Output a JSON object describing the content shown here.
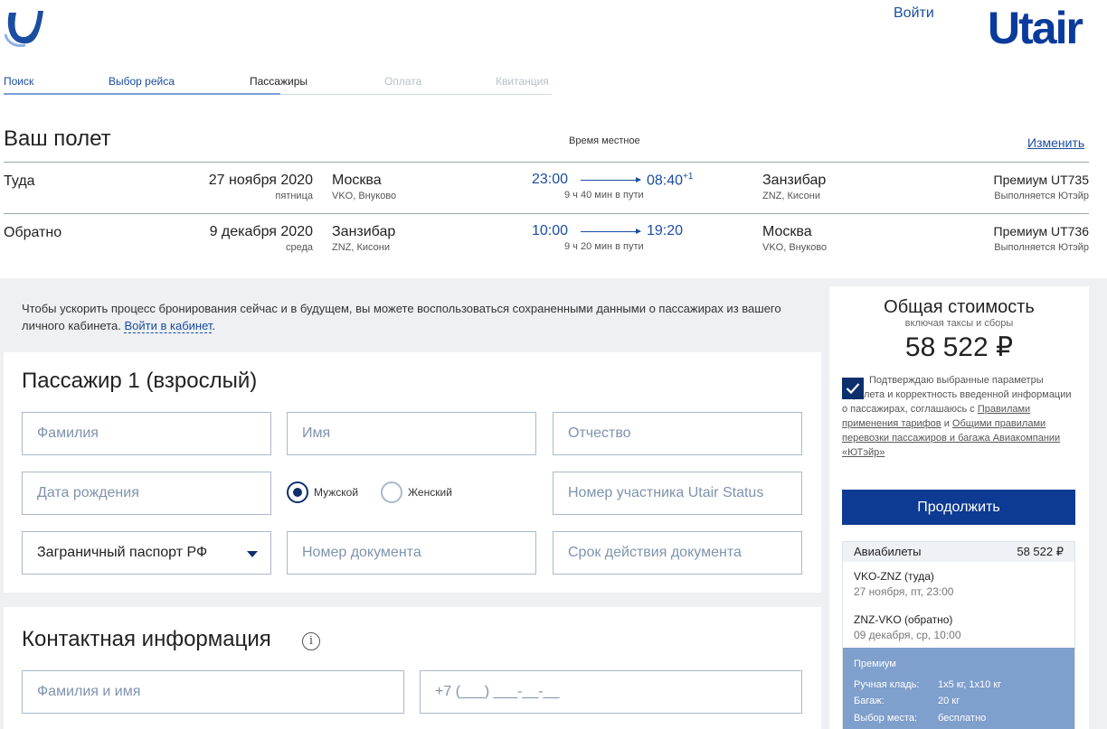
{
  "header": {
    "login": "Войти",
    "brand": "Utair"
  },
  "steps": [
    {
      "label": "Поиск",
      "state": "done"
    },
    {
      "label": "Выбор рейса",
      "state": "done"
    },
    {
      "label": "Пассажиры",
      "state": "active"
    },
    {
      "label": "Оплата",
      "state": "future"
    },
    {
      "label": "Квитанция",
      "state": "future"
    }
  ],
  "flight": {
    "title": "Ваш полет",
    "local_time_note": "Время местное",
    "change_link": "Изменить",
    "legs": [
      {
        "direction": "Туда",
        "date": "27 ноября 2020",
        "weekday": "пятница",
        "from_city": "Москва",
        "from_airport": "VKO, Внуково",
        "dep_time": "23:00",
        "arr_time": "08:40",
        "arr_day_offset": "+1",
        "duration": "9 ч 40 мин в пути",
        "to_city": "Занзибар",
        "to_airport": "ZNZ, Кисони",
        "fare": "Премиум UT735",
        "operator": "Выполняется Ютэйр"
      },
      {
        "direction": "Обратно",
        "date": "9 декабря 2020",
        "weekday": "среда",
        "from_city": "Занзибар",
        "from_airport": "ZNZ, Кисони",
        "dep_time": "10:00",
        "arr_time": "19:20",
        "arr_day_offset": "",
        "duration": "9 ч 20 мин в пути",
        "to_city": "Москва",
        "to_airport": "VKO, Внуково",
        "fare": "Премиум UT736",
        "operator": "Выполняется Ютэйр"
      }
    ]
  },
  "cabinet_note": {
    "text": "Чтобы ускорить процесс бронирования сейчас и в будущем, вы можете воспользоваться сохраненными данными о пассажирах из вашего личного кабинета.",
    "text_before_link": "Чтобы ускорить процесс бронирования сейчас и в будущем, вы можете воспользоваться сохраненными данными о пассажирах из вашего личного кабинета. ",
    "link": "Войти в кабинет",
    "after_link": "."
  },
  "passenger": {
    "title": "Пассажир 1 (взрослый)",
    "last_name_placeholder": "Фамилия",
    "first_name_placeholder": "Имя",
    "middle_name_placeholder": "Отчество",
    "birth_date_placeholder": "Дата рождения",
    "gender_male": "Мужской",
    "gender_female": "Женский",
    "gender_selected": "male",
    "status_number_placeholder": "Номер участника Utair Status",
    "document_type": "Заграничный паспорт РФ",
    "document_number_placeholder": "Номер документа",
    "document_expiry_placeholder": "Срок действия документа"
  },
  "contact": {
    "title": "Контактная информация",
    "info_icon_glyph": "i",
    "name_placeholder": "Фамилия и имя",
    "phone_placeholder": "+7 (___) ___-__-__"
  },
  "summary": {
    "title": "Общая стоимость",
    "subtitle": "включая таксы и сборы",
    "total": "58 522 ₽",
    "agree_checked": true,
    "agree_text_1": "Подтверждаю выбранные параметры перелета и корректность введенной информации о пассажирах, соглашаюсь с",
    "agree_link_1": "Правилами применения тарифов",
    "agree_text_2": "и",
    "agree_link_2": "Общими правилами перевозки пассажиров и багажа Авиакомпании «ЮТэйр»",
    "continue_label": "Продолжить",
    "tickets": {
      "label": "Авиабилеты",
      "amount": "58 522 ₽",
      "legs": [
        {
          "route": "VKO-ZNZ (туда)",
          "when": "27 ноября, пт, 23:00"
        },
        {
          "route": "ZNZ-VKO (обратно)",
          "when": "09 декабря, ср, 10:00"
        }
      ],
      "fare": {
        "title": "Премиум",
        "rows": [
          {
            "key": "Ручная кладь:",
            "value": "1х5 кг, 1х10 кг"
          },
          {
            "key": "Багаж:",
            "value": "20 кг"
          },
          {
            "key": "Выбор места:",
            "value": "бесплатно"
          }
        ]
      }
    }
  },
  "colors": {
    "brand": "#0a3b9c",
    "link": "#1b4da0",
    "button": "#0d3a92",
    "premium_panel": "#7f9fcc"
  }
}
